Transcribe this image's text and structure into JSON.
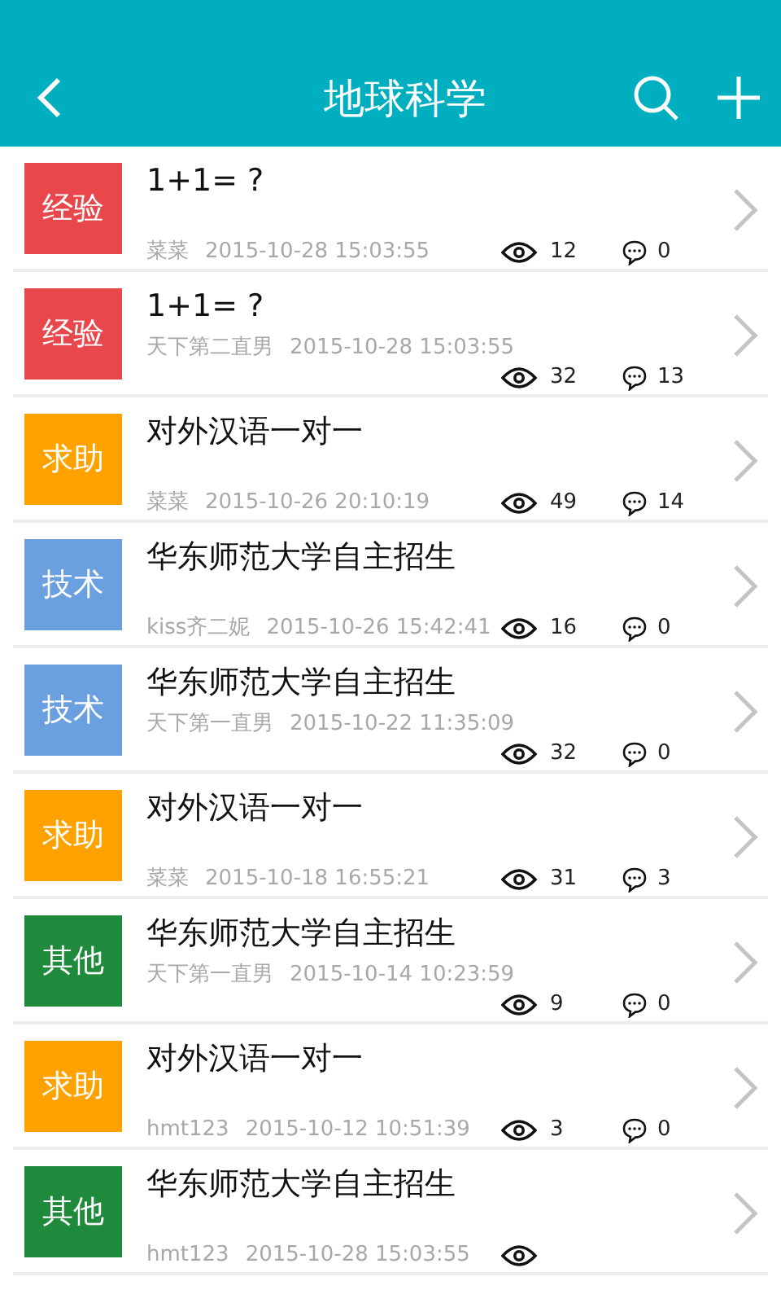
{
  "header": {
    "title": "地球科学"
  },
  "posts": [
    {
      "category": "经验",
      "color": "#e8474c",
      "title": "1+1= ?",
      "author": "菜菜",
      "time": "2015-10-28 15:03:55",
      "views": "12",
      "comments": "0"
    },
    {
      "category": "经验",
      "color": "#e8474c",
      "title": "1+1= ?",
      "author": "天下第二直男",
      "time": "2015-10-28 15:03:55",
      "views": "32",
      "comments": "13"
    },
    {
      "category": "求助",
      "color": "#ffa200",
      "title": "对外汉语一对一",
      "author": "菜菜",
      "time": "2015-10-26 20:10:19",
      "views": "49",
      "comments": "14"
    },
    {
      "category": "技术",
      "color": "#6a9fe0",
      "title": "华东师范大学自主招生",
      "author": "kiss齐二妮",
      "time": "2015-10-26 15:42:41",
      "views": "16",
      "comments": "0"
    },
    {
      "category": "技术",
      "color": "#6a9fe0",
      "title": "华东师范大学自主招生",
      "author": "天下第一直男",
      "time": "2015-10-22 11:35:09",
      "views": "32",
      "comments": "0"
    },
    {
      "category": "求助",
      "color": "#ffa200",
      "title": "对外汉语一对一",
      "author": "菜菜",
      "time": "2015-10-18 16:55:21",
      "views": "31",
      "comments": "3"
    },
    {
      "category": "其他",
      "color": "#1f8a3c",
      "title": "华东师范大学自主招生",
      "author": "天下第一直男",
      "time": "2015-10-14 10:23:59",
      "views": "9",
      "comments": "0"
    },
    {
      "category": "求助",
      "color": "#ffa200",
      "title": "对外汉语一对一",
      "author": "hmt123",
      "time": "2015-10-12 10:51:39",
      "views": "3",
      "comments": "0"
    },
    {
      "category": "其他",
      "color": "#1f8a3c",
      "title": "华东师范大学自主招生",
      "author": "hmt123",
      "time": "2015-10-28 15:03:55"
    }
  ]
}
